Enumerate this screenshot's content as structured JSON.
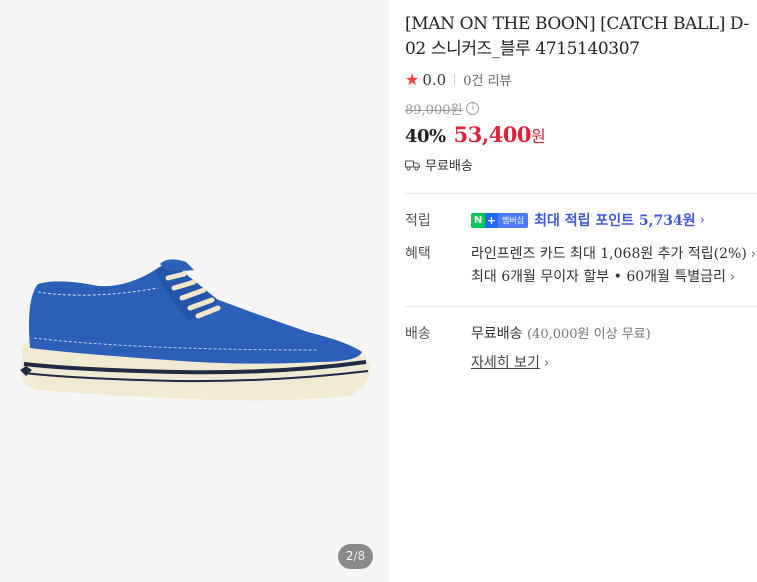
{
  "gallery": {
    "current": "2",
    "separator": "/",
    "total": "8"
  },
  "product": {
    "title": "[MAN ON THE BOON] [CATCH BALL] D-02 스니커즈_블루 4715140307",
    "rating": "0.0",
    "reviews": "0건 리뷰",
    "original_price": "89,000원",
    "discount": "40%",
    "sale_price": "53,400",
    "sale_currency": "원",
    "delivery": "무료배송"
  },
  "points": {
    "label": "적립",
    "badge_n": "N",
    "badge_plus": "+",
    "badge_member": "멤버십",
    "text": "최대 적립 포인트 5,734원"
  },
  "benefits": {
    "label": "혜택",
    "line1": "라인프렌즈 카드 최대 1,068원 추가 적립(2%)",
    "line2": "최대 6개월 무이자 할부 • 60개월 특별금리"
  },
  "shipping": {
    "label": "배송",
    "main": "무료배송",
    "sub": "(40,000원 이상 무료)",
    "detail_link": "자세히 보기"
  },
  "colors": {
    "sale_red": "#e0213a",
    "star_red": "#f1433c",
    "points_blue": "#3e5ad8",
    "naver_green": "#03c75a"
  },
  "icons": [
    "star-icon",
    "info-icon",
    "truck-icon",
    "chevron-right-icon",
    "naver-plus-membership-badge"
  ]
}
